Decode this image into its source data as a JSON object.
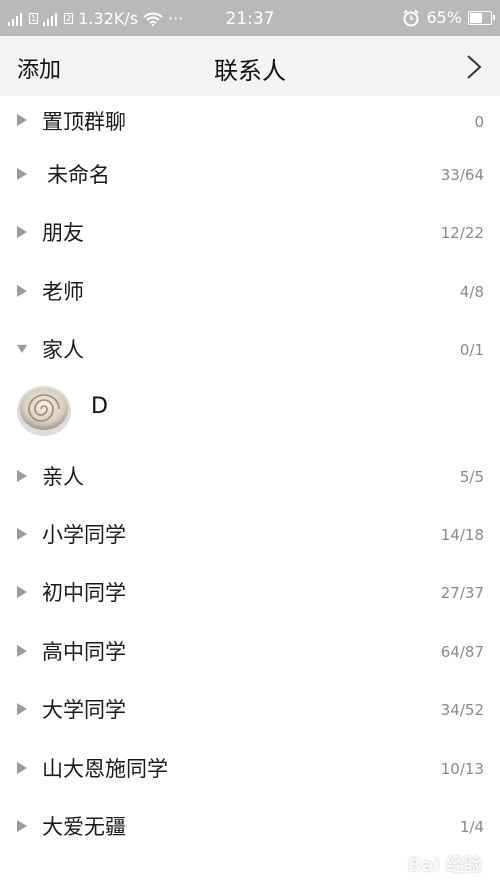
{
  "status_bar": {
    "network_speed": "1.32K/s",
    "dots": "···",
    "time": "21:37",
    "battery": "65%",
    "battery_level": 0.65
  },
  "header": {
    "add_label": "添加",
    "title": "联系人"
  },
  "groups": [
    {
      "name": "置顶群聊",
      "count": "0",
      "expanded": false
    },
    {
      "name": "未命名",
      "count": "33/64",
      "expanded": false
    },
    {
      "name": "朋友",
      "count": "12/22",
      "expanded": false
    },
    {
      "name": "老师",
      "count": "4/8",
      "expanded": false
    },
    {
      "name": "家人",
      "count": "0/1",
      "expanded": true
    },
    {
      "name": "亲人",
      "count": "5/5",
      "expanded": false
    },
    {
      "name": "小学同学",
      "count": "14/18",
      "expanded": false
    },
    {
      "name": "初中同学",
      "count": "27/37",
      "expanded": false
    },
    {
      "name": "高中同学",
      "count": "64/87",
      "expanded": false
    },
    {
      "name": "大学同学",
      "count": "34/52",
      "expanded": false
    },
    {
      "name": "山大恩施同学",
      "count": "10/13",
      "expanded": false
    },
    {
      "name": "大爱无疆",
      "count": "1/4",
      "expanded": false
    }
  ],
  "contact": {
    "name": "D",
    "icon": "avatar-image"
  },
  "watermark": "Bai 经验"
}
